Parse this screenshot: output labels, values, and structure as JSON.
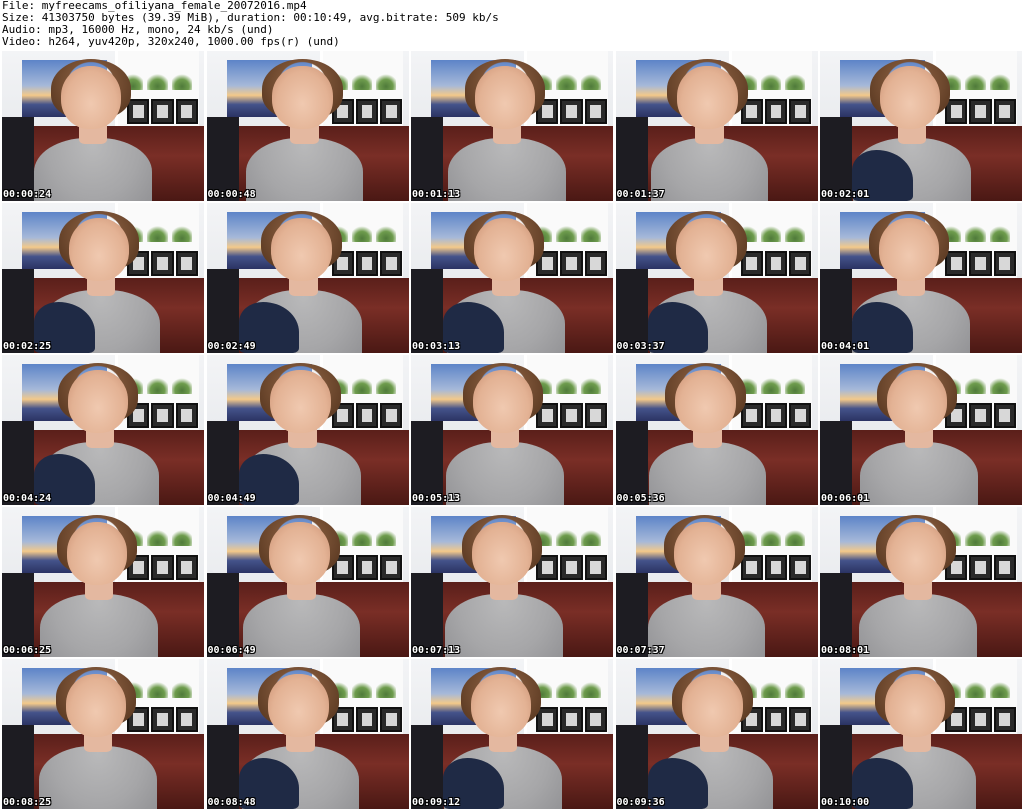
{
  "header": {
    "file_line": "File: myfreecams_ofiliyana_female_20072016.mp4",
    "size_line": "Size: 41303750 bytes (39.39 MiB), duration: 00:10:49, avg.bitrate: 509 kb/s",
    "audio_line": "Audio: mp3, 16000 Hz, mono, 24 kb/s (und)",
    "video_line": "Video: h264, yuv420p, 320x240, 1000.00 fps(r) (und)"
  },
  "thumbnails": [
    {
      "time": "00:00:24",
      "cloth": false
    },
    {
      "time": "00:00:48",
      "cloth": false
    },
    {
      "time": "00:01:13",
      "cloth": false
    },
    {
      "time": "00:01:37",
      "cloth": false
    },
    {
      "time": "00:02:01",
      "cloth": true
    },
    {
      "time": "00:02:25",
      "cloth": true
    },
    {
      "time": "00:02:49",
      "cloth": true
    },
    {
      "time": "00:03:13",
      "cloth": true
    },
    {
      "time": "00:03:37",
      "cloth": true
    },
    {
      "time": "00:04:01",
      "cloth": true
    },
    {
      "time": "00:04:24",
      "cloth": true
    },
    {
      "time": "00:04:49",
      "cloth": true
    },
    {
      "time": "00:05:13",
      "cloth": false
    },
    {
      "time": "00:05:36",
      "cloth": false
    },
    {
      "time": "00:06:01",
      "cloth": false
    },
    {
      "time": "00:06:25",
      "cloth": false
    },
    {
      "time": "00:06:49",
      "cloth": false
    },
    {
      "time": "00:07:13",
      "cloth": false
    },
    {
      "time": "00:07:37",
      "cloth": false
    },
    {
      "time": "00:08:01",
      "cloth": false
    },
    {
      "time": "00:08:25",
      "cloth": false
    },
    {
      "time": "00:08:48",
      "cloth": true
    },
    {
      "time": "00:09:12",
      "cloth": true
    },
    {
      "time": "00:09:36",
      "cloth": true
    },
    {
      "time": "00:10:00",
      "cloth": true
    }
  ]
}
